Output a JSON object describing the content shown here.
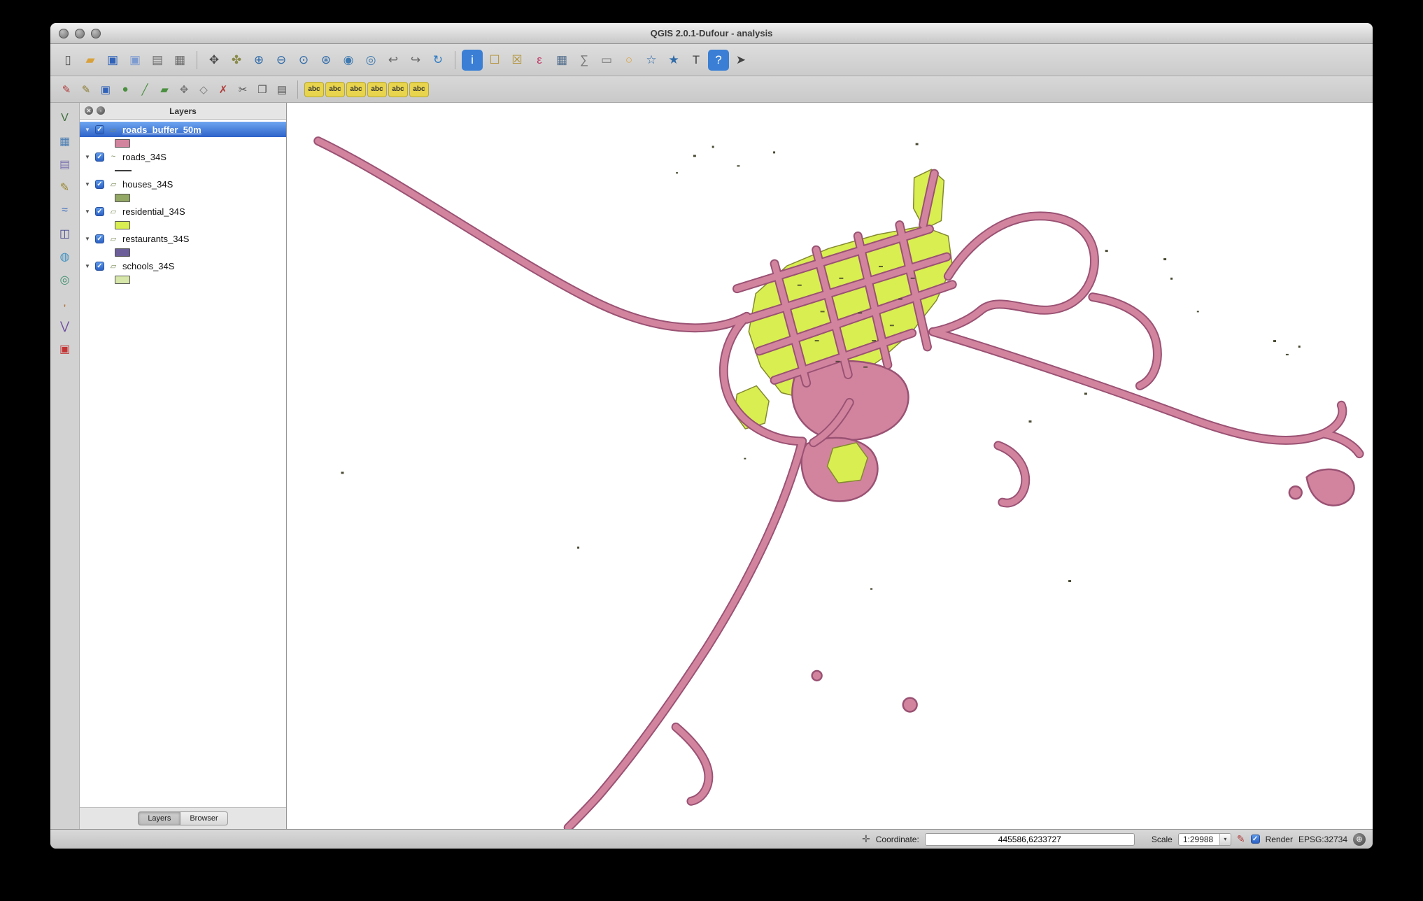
{
  "window": {
    "title": "QGIS 2.0.1-Dufour - analysis"
  },
  "colors": {
    "road-fill": "#d2849f",
    "road-stroke": "#9a5273",
    "residential-fill": "#d9ee51",
    "residential-stroke": "#83892f",
    "canvas-bg": "#ffffff",
    "selection-top": "#6ea6f0",
    "selection-bottom": "#2d62c9"
  },
  "toolbars": {
    "file": [
      {
        "name": "new-project-icon",
        "glyph": "▯",
        "fg": "#555555"
      },
      {
        "name": "open-project-icon",
        "glyph": "▰",
        "fg": "#d9a13b"
      },
      {
        "name": "save-project-icon",
        "glyph": "▣",
        "fg": "#2f62b8"
      },
      {
        "name": "save-project-as-icon",
        "glyph": "▣",
        "fg": "#7e9bd0"
      },
      {
        "name": "new-print-composer-icon",
        "glyph": "▤",
        "fg": "#6e6e6e"
      },
      {
        "name": "composer-manager-icon",
        "glyph": "▦",
        "fg": "#6e6e6e"
      }
    ],
    "navigation": [
      {
        "name": "pan-map-icon",
        "glyph": "✥",
        "fg": "#4a4a4a"
      },
      {
        "name": "pan-to-selection-icon",
        "glyph": "✤",
        "fg": "#8a8a4a"
      },
      {
        "name": "zoom-in-icon",
        "glyph": "⊕",
        "fg": "#2f6aa8"
      },
      {
        "name": "zoom-out-icon",
        "glyph": "⊖",
        "fg": "#2f6aa8"
      },
      {
        "name": "zoom-native-icon",
        "glyph": "⊙",
        "fg": "#2f6aa8"
      },
      {
        "name": "zoom-full-icon",
        "glyph": "⊛",
        "fg": "#2f6aa8"
      },
      {
        "name": "zoom-to-selection-icon",
        "glyph": "◉",
        "fg": "#3f7ab0"
      },
      {
        "name": "zoom-to-layer-icon",
        "glyph": "◎",
        "fg": "#3f7ab0"
      },
      {
        "name": "zoom-last-icon",
        "glyph": "↩",
        "fg": "#666666"
      },
      {
        "name": "zoom-next-icon",
        "glyph": "↪",
        "fg": "#666666"
      },
      {
        "name": "refresh-icon",
        "glyph": "↻",
        "fg": "#2e7bc4"
      }
    ],
    "attributes": [
      {
        "name": "identify-features-icon",
        "glyph": "i",
        "fg": "#ffffff",
        "bg": "#3a7fd5"
      },
      {
        "name": "select-features-icon",
        "glyph": "☐",
        "fg": "#b08f2f"
      },
      {
        "name": "deselect-features-icon",
        "glyph": "☒",
        "fg": "#b08f2f"
      },
      {
        "name": "select-by-expression-icon",
        "glyph": "ε",
        "fg": "#c23b69"
      },
      {
        "name": "open-attribute-table-icon",
        "glyph": "▦",
        "fg": "#55708e"
      },
      {
        "name": "field-calculator-icon",
        "glyph": "∑",
        "fg": "#777777"
      },
      {
        "name": "measure-icon",
        "glyph": "▭",
        "fg": "#777777"
      },
      {
        "name": "map-tips-icon",
        "glyph": "○",
        "fg": "#d9a13b"
      },
      {
        "name": "new-bookmark-icon",
        "glyph": "☆",
        "fg": "#2f6aa8"
      },
      {
        "name": "show-bookmarks-icon",
        "glyph": "★",
        "fg": "#2f6aa8"
      },
      {
        "name": "text-annotation-icon",
        "glyph": "T",
        "fg": "#444444"
      },
      {
        "name": "help-icon",
        "glyph": "?",
        "fg": "#ffffff",
        "bg": "#3a7fd5"
      },
      {
        "name": "whats-this-icon",
        "glyph": "➤",
        "fg": "#444444"
      }
    ],
    "digitizing": [
      {
        "name": "current-edits-icon",
        "glyph": "✎",
        "fg": "#b03a3a"
      },
      {
        "name": "toggle-editing-icon",
        "glyph": "✎",
        "fg": "#8a7a2f"
      },
      {
        "name": "save-layer-edits-icon",
        "glyph": "▣",
        "fg": "#2f62b8"
      },
      {
        "name": "add-feature-point-icon",
        "glyph": "●",
        "fg": "#4a8f3f"
      },
      {
        "name": "add-feature-line-icon",
        "glyph": "╱",
        "fg": "#4a8f3f"
      },
      {
        "name": "add-feature-polygon-icon",
        "glyph": "▰",
        "fg": "#4a8f3f"
      },
      {
        "name": "move-feature-icon",
        "glyph": "✥",
        "fg": "#777777"
      },
      {
        "name": "node-tool-icon",
        "glyph": "◇",
        "fg": "#777777"
      },
      {
        "name": "delete-selected-icon",
        "glyph": "✗",
        "fg": "#b03a3a"
      },
      {
        "name": "cut-features-icon",
        "glyph": "✂",
        "fg": "#555555"
      },
      {
        "name": "copy-features-icon",
        "glyph": "❐",
        "fg": "#555555"
      },
      {
        "name": "paste-features-icon",
        "glyph": "▤",
        "fg": "#555555"
      }
    ],
    "labels": [
      {
        "name": "labeling-options-icon",
        "glyph": "abc",
        "fg": "#333333",
        "bg": "#e8d44d"
      },
      {
        "name": "label-text-icon",
        "glyph": "abc",
        "fg": "#333333",
        "bg": "#e8d44d"
      },
      {
        "name": "label-placement-icon",
        "glyph": "abc",
        "fg": "#333333",
        "bg": "#e8d44d"
      },
      {
        "name": "label-buffer-icon",
        "glyph": "abc",
        "fg": "#333333",
        "bg": "#e8d44d"
      },
      {
        "name": "label-position-icon",
        "glyph": "abc",
        "fg": "#333333",
        "bg": "#e8d44d"
      },
      {
        "name": "label-rotation-icon",
        "glyph": "abc",
        "fg": "#333333",
        "bg": "#e8d44d"
      }
    ],
    "manage_layers": [
      {
        "name": "add-vector-layer-icon",
        "glyph": "V",
        "fg": "#3f6f3f"
      },
      {
        "name": "add-raster-layer-icon",
        "glyph": "▦",
        "fg": "#4d7fb3"
      },
      {
        "name": "add-database-layer-icon",
        "glyph": "▤",
        "fg": "#7a6fae"
      },
      {
        "name": "new-shapefile-layer-icon",
        "glyph": "✎",
        "fg": "#98862f"
      },
      {
        "name": "add-spatialite-layer-icon",
        "glyph": "≈",
        "fg": "#3f6fbf"
      },
      {
        "name": "add-postgis-layer-icon",
        "glyph": "◫",
        "fg": "#45458f"
      },
      {
        "name": "add-wms-layer-icon",
        "glyph": "◍",
        "fg": "#3f8fbf"
      },
      {
        "name": "add-wcs-layer-icon",
        "glyph": "◎",
        "fg": "#3f8f6f"
      },
      {
        "name": "add-delimited-text-layer-icon",
        "glyph": ",",
        "fg": "#b06f2f"
      },
      {
        "name": "add-wfs-layer-icon",
        "glyph": "⋁",
        "fg": "#6f4fa0"
      },
      {
        "name": "remove-layer-icon",
        "glyph": "▣",
        "fg": "#c33333"
      }
    ]
  },
  "layers_panel": {
    "title": "Layers",
    "tabs": [
      "Layers",
      "Browser"
    ],
    "layers": [
      {
        "label": "roads_buffer_50m",
        "icon": "▱",
        "swatch": "#d2849f",
        "selected": true
      },
      {
        "label": "roads_34S",
        "icon": "~",
        "swatch": "#3c3c3c",
        "symbol": "line"
      },
      {
        "label": "houses_34S",
        "icon": "▱",
        "swatch": "#93a865"
      },
      {
        "label": "residential_34S",
        "icon": "▱",
        "swatch": "#d9ee51"
      },
      {
        "label": "restaurants_34S",
        "icon": "▱",
        "swatch": "#6b5e99"
      },
      {
        "label": "schools_34S",
        "icon": "▱",
        "swatch": "#d6e7a9"
      }
    ]
  },
  "status_bar": {
    "coordinate_label": "Coordinate:",
    "coordinate_value": "445586,6233727",
    "scale_label": "Scale",
    "scale_value": "1:29988",
    "render_label": "Render",
    "epsg": "EPSG:32734"
  }
}
